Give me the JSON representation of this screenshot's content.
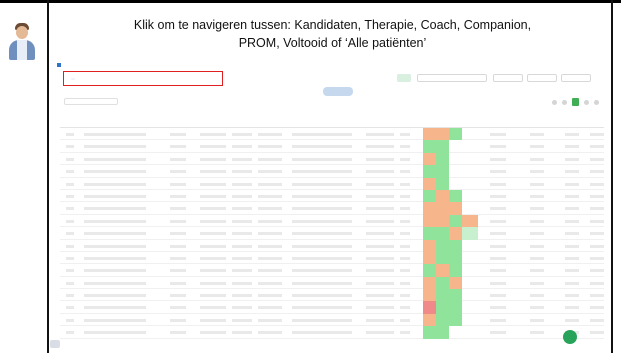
{
  "instruction": {
    "line1": "Klik om te navigeren tussen: Kandidaten, Therapie, Coach, Companion,",
    "line2": "PROM, Voltooid of ‘Alle patiënten’"
  },
  "app": {
    "brand": "",
    "nav": [],
    "user": "",
    "tabs": [
      {
        "label": "",
        "active": false
      },
      {
        "label": "",
        "active": true
      },
      {
        "label": "",
        "active": false
      },
      {
        "label": "",
        "active": false
      },
      {
        "label": "",
        "active": false
      },
      {
        "label": "",
        "active": false
      },
      {
        "label": "",
        "active": false
      }
    ],
    "center_button": "",
    "search_placeholder": "",
    "filter_placeholder": ""
  },
  "colors": {
    "highlight": "#e02020",
    "orange": "#f6b58a",
    "green": "#8fe39a",
    "red": "#f08a8a",
    "fab": "#27a35a"
  },
  "icons": [
    "doctor-avatar-icon",
    "chat-fab-icon"
  ],
  "table": {
    "headers": [],
    "rows": [
      {
        "status": [
          "or",
          "or",
          "gr",
          "",
          ""
        ]
      },
      {
        "status": [
          "gr",
          "gr",
          "",
          "",
          ""
        ]
      },
      {
        "status": [
          "or",
          "gr",
          "",
          "",
          ""
        ]
      },
      {
        "status": [
          "gr",
          "gr",
          "",
          "",
          ""
        ]
      },
      {
        "status": [
          "or",
          "gr",
          "",
          "",
          ""
        ]
      },
      {
        "status": [
          "gr",
          "or",
          "gr",
          "",
          ""
        ]
      },
      {
        "status": [
          "or",
          "or",
          "or",
          "",
          ""
        ]
      },
      {
        "status": [
          "or",
          "or",
          "gr",
          "or",
          ""
        ]
      },
      {
        "status": [
          "gr",
          "gr",
          "or",
          "lg",
          ""
        ]
      },
      {
        "status": [
          "or",
          "gr",
          "gr",
          "",
          ""
        ]
      },
      {
        "status": [
          "or",
          "gr",
          "gr",
          "",
          ""
        ]
      },
      {
        "status": [
          "gr",
          "or",
          "gr",
          "",
          ""
        ]
      },
      {
        "status": [
          "or",
          "gr",
          "or",
          "",
          ""
        ]
      },
      {
        "status": [
          "or",
          "gr",
          "gr",
          "",
          ""
        ]
      },
      {
        "status": [
          "rd",
          "gr",
          "gr",
          "",
          ""
        ]
      },
      {
        "status": [
          "or",
          "gr",
          "gr",
          "",
          ""
        ]
      },
      {
        "status": [
          "gr",
          "gr",
          "",
          "",
          ""
        ]
      }
    ]
  }
}
